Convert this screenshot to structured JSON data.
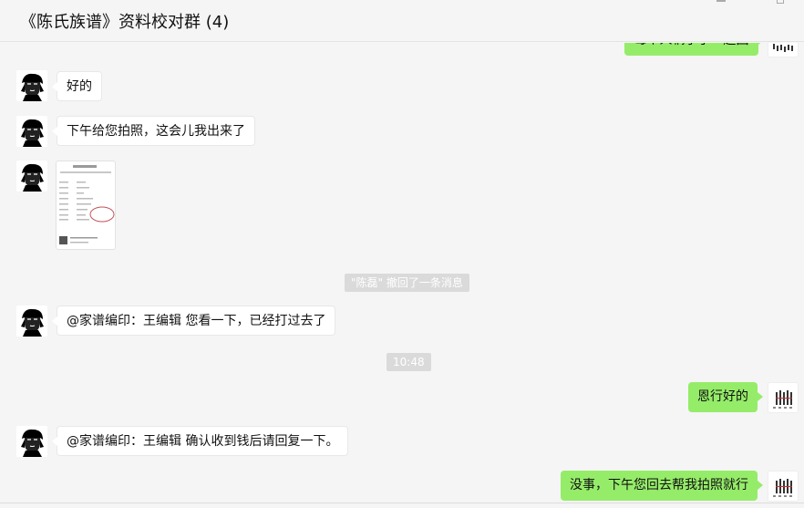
{
  "window": {
    "title": "《陈氏族谱》资料校对群 (4)"
  },
  "messages": {
    "cut_top": "每个人辆子了一趟回",
    "m1": "好的",
    "m2": "下午给您拍照，这会儿我出来了",
    "recall_notice": "\"陈磊\" 撤回了一条消息",
    "m3": "@家谱编印：王编辑 您看一下，已经打过去了",
    "time_1": "10:48",
    "m4": "恩行好的",
    "m5": "@家谱编印：王编辑 确认收到钱后请回复一下。",
    "m6": "没事，下午您回去帮我拍照就行"
  },
  "colors": {
    "outgoing_bubble": "#95ec69",
    "incoming_bubble": "#ffffff",
    "background": "#f5f5f5"
  }
}
